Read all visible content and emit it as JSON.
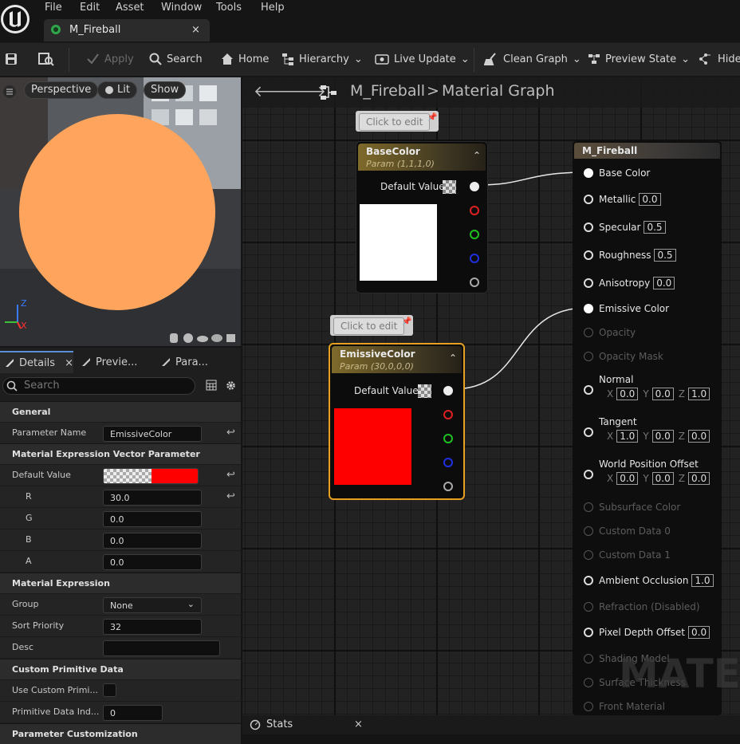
{
  "menu": [
    "File",
    "Edit",
    "Asset",
    "Window",
    "Tools",
    "Help"
  ],
  "tab": {
    "title": "M_Fireball",
    "close": "×"
  },
  "toolbar": {
    "apply": "Apply",
    "search": "Search",
    "home": "Home",
    "hierarchy": "Hierarchy",
    "live_update": "Live Update",
    "clean_graph": "Clean Graph",
    "preview_state": "Preview State",
    "hide": "Hide"
  },
  "viewport": {
    "perspective": "Perspective",
    "lit": "Lit",
    "show": "Show",
    "axis_z": "Z",
    "axis_x": "X",
    "sphere_color": "#ffa45c"
  },
  "details": {
    "tabs": [
      "Details",
      "Previe...",
      "Para..."
    ],
    "tab_close": "×",
    "search_placeholder": "Search",
    "sections": {
      "general": "General",
      "vector": "Material Expression Vector Parameter",
      "expression": "Material Expression",
      "custom": "Custom Primitive Data",
      "param_custom": "Parameter Customization"
    },
    "rows": {
      "param_name_label": "Parameter Name",
      "param_name": "EmissiveColor",
      "default_value_label": "Default Value",
      "default_value_color": "#ff0000",
      "r_label": "R",
      "r": "30.0",
      "g_label": "G",
      "g": "0.0",
      "b_label": "B",
      "b": "0.0",
      "a_label": "A",
      "a": "0.0",
      "group_label": "Group",
      "group": "None",
      "sort_label": "Sort Priority",
      "sort": "32",
      "desc_label": "Desc",
      "desc": "",
      "use_custom_label": "Use Custom Primi...",
      "prim_index_label": "Primitive Data Ind...",
      "prim_index": "0"
    }
  },
  "graph": {
    "breadcrumb_root": "M_Fireball",
    "breadcrumb_sep": ">",
    "breadcrumb_leaf": "Material Graph",
    "comment": "Click to edit",
    "base_node": {
      "title": "BaseColor",
      "subtitle": "Param (1,1,1,0)",
      "pin": "Default Value",
      "swatch": "#ffffff"
    },
    "emissive_node": {
      "title": "EmissiveColor",
      "subtitle": "Param (30,0,0,0)",
      "pin": "Default Value",
      "swatch": "#ff0000"
    },
    "output_node": {
      "title": "M_Fireball",
      "inputs": [
        {
          "label": "Base Color",
          "value": "",
          "active": true
        },
        {
          "label": "Metallic",
          "value": "0.0",
          "active": true
        },
        {
          "label": "Specular",
          "value": "0.5",
          "active": true
        },
        {
          "label": "Roughness",
          "value": "0.5",
          "active": true
        },
        {
          "label": "Anisotropy",
          "value": "0.0",
          "active": true
        },
        {
          "label": "Emissive Color",
          "value": "",
          "active": true
        },
        {
          "label": "Opacity",
          "value": "",
          "active": false
        },
        {
          "label": "Opacity Mask",
          "value": "",
          "active": false
        }
      ],
      "normal": {
        "label": "Normal",
        "x": "0.0",
        "y": "0.0",
        "z": "1.0"
      },
      "tangent": {
        "label": "Tangent",
        "x": "1.0",
        "y": "0.0",
        "z": "0.0"
      },
      "wpo": {
        "label": "World Position Offset",
        "x": "0.0",
        "y": "0.0",
        "z": "0.0"
      },
      "lower": [
        {
          "label": "Subsurface Color",
          "value": "",
          "active": false
        },
        {
          "label": "Custom Data 0",
          "value": "",
          "active": false
        },
        {
          "label": "Custom Data 1",
          "value": "",
          "active": false
        },
        {
          "label": "Ambient Occlusion",
          "value": "1.0",
          "active": true
        },
        {
          "label": "Refraction (Disabled)",
          "value": "",
          "active": false
        },
        {
          "label": "Pixel Depth Offset",
          "value": "0.0",
          "active": true
        },
        {
          "label": "Shading Model",
          "value": "",
          "active": false
        },
        {
          "label": "Surface Thickness",
          "value": "",
          "active": false
        },
        {
          "label": "Front Material",
          "value": "",
          "active": false
        }
      ]
    },
    "watermark": "MATE",
    "axis_x": "X",
    "axis_y": "Y",
    "axis_z": "Z"
  },
  "stats": {
    "label": "Stats",
    "close": "×"
  }
}
